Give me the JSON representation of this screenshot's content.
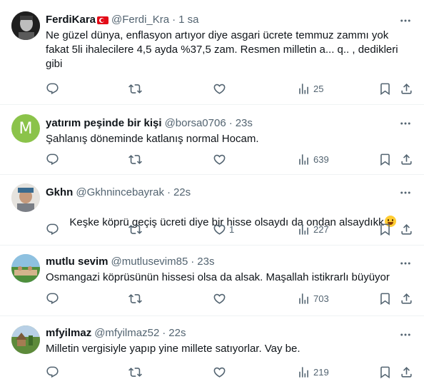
{
  "tweets": [
    {
      "display_name": "FerdiKara",
      "handle": "@Ferdi_Kra",
      "time": "1 sa",
      "separator": "·",
      "text": "Ne güzel dünya, enflasyon artıyor diye asgari ücrete temmuz zammı yok fakat 5li ihalecilere 4,5 ayda %37,5 zam. Resmen milletin a... q.. , dedikleri gibi",
      "reply_count": "",
      "retweet_count": "",
      "like_count": "",
      "views": "25"
    },
    {
      "display_name": "yatırım peşinde bir kişi",
      "handle": "@borsa0706",
      "time": "23s",
      "separator": "·",
      "avatar_letter": "M",
      "text": "Şahlanış döneminde katlanış normal Hocam.",
      "reply_count": "",
      "retweet_count": "",
      "like_count": "",
      "views": "639"
    },
    {
      "display_name": "Gkhn",
      "handle": "@Gkhnincebayrak",
      "time": "22s",
      "separator": "·",
      "text": "Keşke köprü geçiş ücreti diye bir hisse olsaydı da ondan alsaydıkk",
      "reply_count": "",
      "retweet_count": "",
      "like_count": "1",
      "views": "227"
    },
    {
      "display_name": "mutlu sevim",
      "handle": "@mutlusevim85",
      "time": "23s",
      "separator": "·",
      "text": "Osmangazi köprüsünün hissesi olsa da alsak. Maşallah istikrarlı büyüyor",
      "reply_count": "",
      "retweet_count": "",
      "like_count": "",
      "views": "703"
    },
    {
      "display_name": "mfyilmaz",
      "handle": "@mfyilmaz52",
      "time": "22s",
      "separator": "·",
      "text": "Milletin vergisiyle yapıp yine millete satıyorlar. Vay be.",
      "reply_count": "",
      "retweet_count": "",
      "like_count": "",
      "views": "219"
    }
  ],
  "colors": {
    "text_primary": "#0f1419",
    "text_secondary": "#536471",
    "divider": "#eff3f4",
    "avatar_m_bg": "#8bc34a"
  },
  "icons": [
    "more-icon",
    "reply-icon",
    "retweet-icon",
    "like-icon",
    "views-icon",
    "bookmark-icon",
    "share-icon",
    "turkey-flag-icon",
    "grinning-emoji-icon"
  ]
}
